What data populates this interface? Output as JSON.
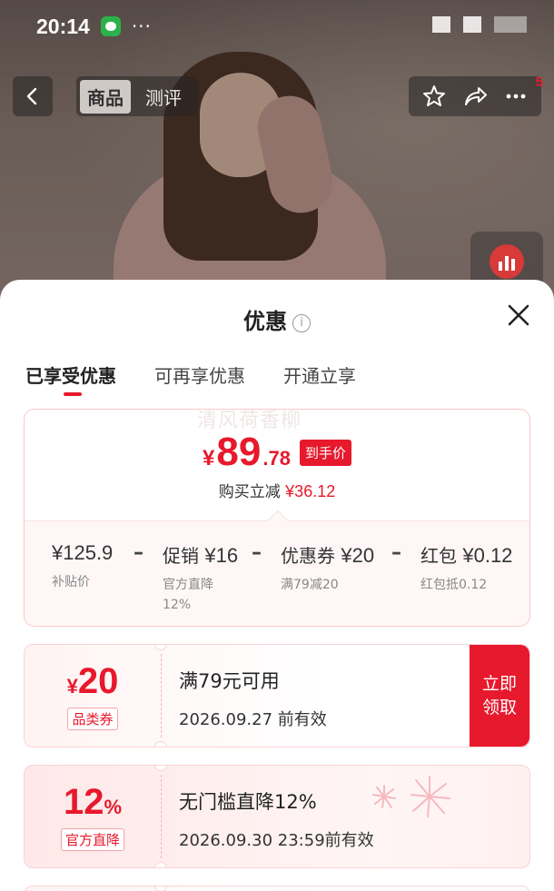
{
  "status_bar": {
    "time": "20:14",
    "more": "···"
  },
  "product_nav": {
    "tabs": [
      "商品",
      "测评"
    ],
    "active_tab": 0,
    "notification_count": "5"
  },
  "sheet": {
    "title": "优惠",
    "info_icon": "i",
    "tabs": [
      "已享受优惠",
      "可再享优惠",
      "开通立享"
    ],
    "active_tab": 0
  },
  "price_card": {
    "watermark": "清风荷香柳",
    "currency": "¥",
    "price_int": "89",
    "price_dec": ".78",
    "price_tag": "到手价",
    "reduce_label": "购买立减",
    "reduce_value": "¥36.12",
    "breakdown": [
      {
        "main_label": "",
        "main_value": "¥125.9",
        "sub": "补贴价"
      },
      {
        "main_label": "促销",
        "main_value": "¥16",
        "sub": "官方直降",
        "sub2": "12%"
      },
      {
        "main_label": "优惠券",
        "main_value": "¥20",
        "sub": "满79减20"
      },
      {
        "main_label": "红包",
        "main_value": "¥0.12",
        "sub": "红包抵0.12"
      }
    ],
    "operator": "–"
  },
  "coupons": [
    {
      "currency": "¥",
      "amount": "20",
      "kind": "品类券",
      "title": "满79元可用",
      "valid": "2026.09.27 前有效",
      "claim": "立即领取"
    },
    {
      "amount": "12",
      "unit": "%",
      "kind": "官方直降",
      "title": "无门槛直降12%",
      "valid": "2026.09.30 23:59前有效"
    }
  ],
  "colors": {
    "accent": "#e7192c",
    "card_border": "#f7c9cc"
  }
}
